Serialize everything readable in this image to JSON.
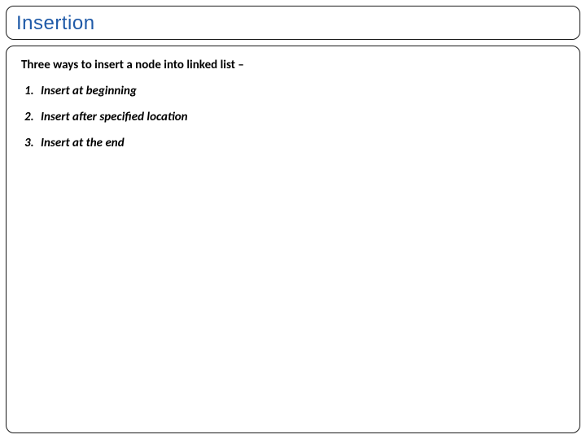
{
  "title": "Insertion",
  "intro": "Three ways to insert a node into linked list –",
  "items": [
    "Insert at beginning",
    "Insert after specified location",
    "Insert at the end"
  ]
}
